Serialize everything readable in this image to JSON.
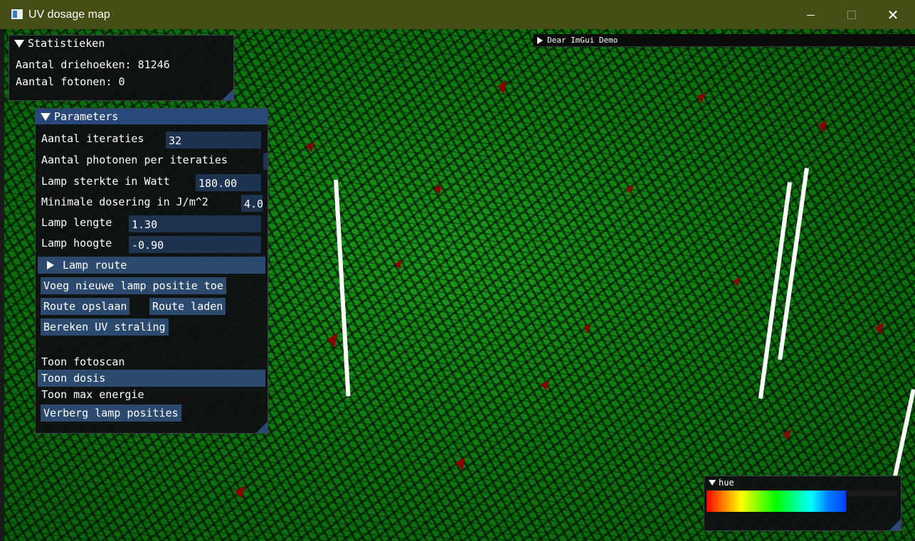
{
  "window": {
    "title": "UV dosage map"
  },
  "stats": {
    "title": "Statistieken",
    "triangles_label": "Aantal driehoeken: 81246",
    "photons_label": "Aantal fotonen: 0"
  },
  "params": {
    "title": "Parameters",
    "iterations_label": "Aantal iteraties",
    "iterations_value": "32",
    "photons_label": "Aantal photonen per iteraties",
    "lamp_power_label": "Lamp sterkte in Watt",
    "lamp_power_value": "180.00",
    "min_dose_label": "Minimale dosering in J/m^2",
    "min_dose_value": "4.0",
    "lamp_length_label": "Lamp lengte",
    "lamp_length_value": "1.30",
    "lamp_height_label": "Lamp hoogte",
    "lamp_height_value": "-0.90",
    "lamp_route_label": "Lamp route",
    "add_position_button": "Voeg nieuwe lamp positie toe",
    "save_route_button": "Route opslaan",
    "load_route_button": "Route laden",
    "compute_button": "Bereken UV straling",
    "show_photoscan": "Toon fotoscan",
    "show_dose": "Toon dosis",
    "show_max_energy": "Toon max energie",
    "hide_lamp_positions": "Verberg lamp posities"
  },
  "demo": {
    "label": "Dear ImGui Demo"
  },
  "hue": {
    "title": "hue"
  },
  "colors": {
    "panel_header": "#29487a",
    "button": "#2b4a6e",
    "input": "#1d3350",
    "mesh": "#0f7a10",
    "hotspot": "#8b0000",
    "titlebar": "#474d16"
  }
}
